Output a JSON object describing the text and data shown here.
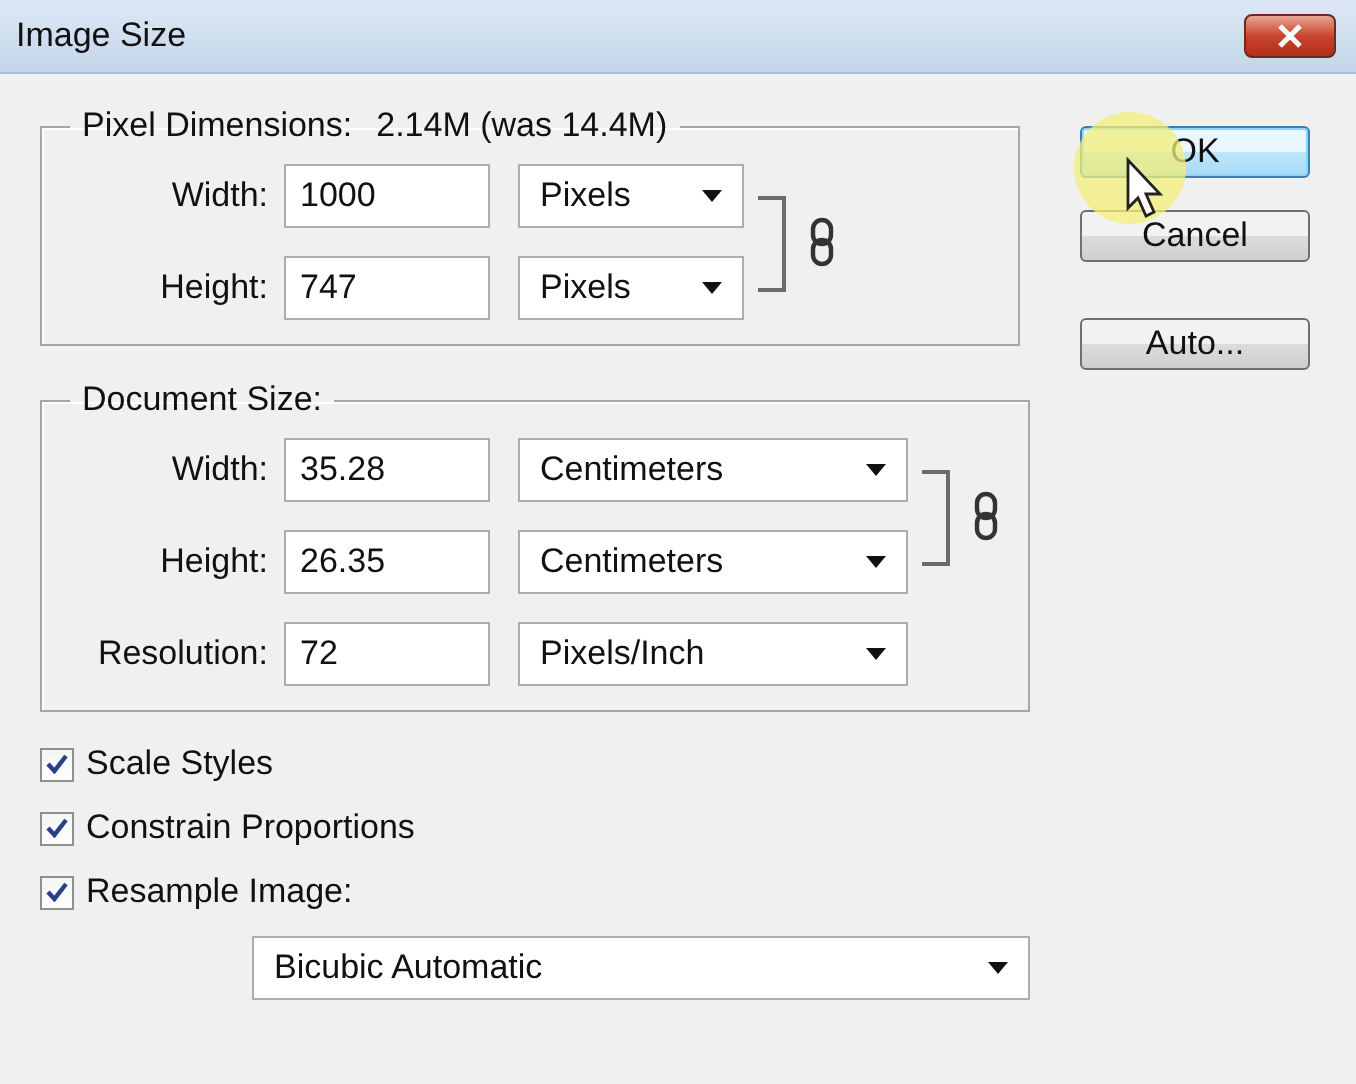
{
  "window": {
    "title": "Image Size"
  },
  "pixel_dimensions": {
    "label": "Pixel Dimensions:",
    "value": "2.14M (was 14.4M)",
    "fields": [
      {
        "label": "Width:",
        "value": "1000",
        "unit": "Pixels"
      },
      {
        "label": "Height:",
        "value": "747",
        "unit": "Pixels"
      }
    ]
  },
  "document_size": {
    "label": "Document Size:",
    "fields": [
      {
        "label": "Width:",
        "value": "35.28",
        "unit": "Centimeters"
      },
      {
        "label": "Height:",
        "value": "26.35",
        "unit": "Centimeters"
      },
      {
        "label": "Resolution:",
        "value": "72",
        "unit": "Pixels/Inch"
      }
    ]
  },
  "options": [
    {
      "label": "Scale Styles",
      "checked": true
    },
    {
      "label": "Constrain Proportions",
      "checked": true
    },
    {
      "label": "Resample Image:",
      "checked": true
    }
  ],
  "resample_method": "Bicubic Automatic",
  "buttons": [
    {
      "label": "OK",
      "default": true
    },
    {
      "label": "Cancel",
      "default": false
    },
    {
      "label": "Auto...",
      "default": false
    }
  ]
}
